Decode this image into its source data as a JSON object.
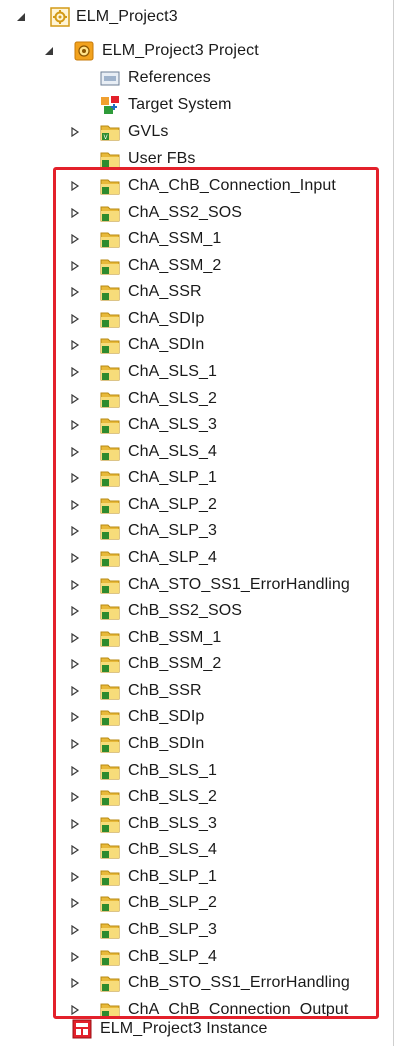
{
  "root": {
    "label": "ELM_Project3"
  },
  "project": {
    "label": "ELM_Project3 Project"
  },
  "references": {
    "label": "References"
  },
  "target_system": {
    "label": "Target System"
  },
  "gvls": {
    "label": "GVLs"
  },
  "user_fbs": {
    "label": "User FBs"
  },
  "folders": [
    "ChA_ChB_Connection_Input",
    "ChA_SS2_SOS",
    "ChA_SSM_1",
    "ChA_SSM_2",
    "ChA_SSR",
    "ChA_SDIp",
    "ChA_SDIn",
    "ChA_SLS_1",
    "ChA_SLS_2",
    "ChA_SLS_3",
    "ChA_SLS_4",
    "ChA_SLP_1",
    "ChA_SLP_2",
    "ChA_SLP_3",
    "ChA_SLP_4",
    "ChA_STO_SS1_ErrorHandling",
    "ChB_SS2_SOS",
    "ChB_SSM_1",
    "ChB_SSM_2",
    "ChB_SSR",
    "ChB_SDIp",
    "ChB_SDIn",
    "ChB_SLS_1",
    "ChB_SLS_2",
    "ChB_SLS_3",
    "ChB_SLS_4",
    "ChB_SLP_1",
    "ChB_SLP_2",
    "ChB_SLP_3",
    "ChB_SLP_4",
    "ChB_STO_SS1_ErrorHandling",
    "ChA_ChB_Connection_Output"
  ],
  "instance": {
    "label": "ELM_Project3 Instance"
  },
  "colors": {
    "highlight": "#e3202a",
    "folder": "#e8b93a",
    "folder_light": "#f7dc7a",
    "gvl_badge": "#2e8b2e"
  }
}
